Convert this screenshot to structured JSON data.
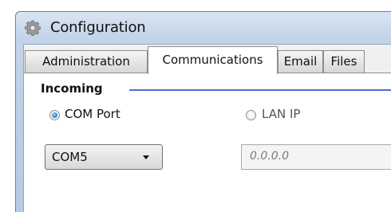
{
  "window": {
    "title": "Configuration",
    "icon": "gear-icon"
  },
  "tabs": [
    {
      "label": "Administration",
      "active": false
    },
    {
      "label": "Communications",
      "active": true
    },
    {
      "label": "Email",
      "active": false
    },
    {
      "label": "Files",
      "active": false
    }
  ],
  "incoming": {
    "group_title": "Incoming",
    "com_port": {
      "label": "COM Port",
      "checked": true
    },
    "lan_ip": {
      "label": "LAN IP",
      "checked": false
    },
    "com_select": {
      "value": "COM5"
    },
    "ip_input": {
      "placeholder": "0.0.0.0"
    }
  },
  "colors": {
    "group_line": "#4f6bd3",
    "radio_selected": "#2d8be0",
    "title_bar": "#c3d4ea"
  }
}
